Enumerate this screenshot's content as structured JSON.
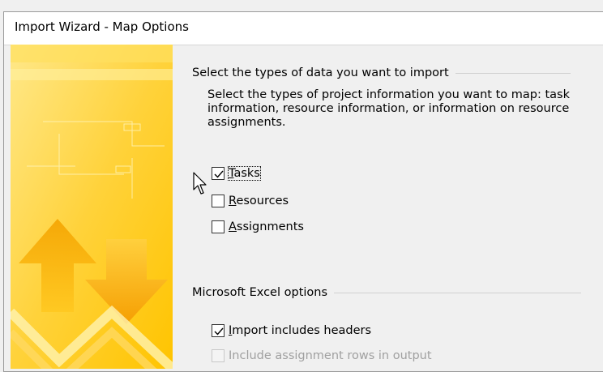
{
  "dialog": {
    "title": "Import Wizard - Map Options"
  },
  "section_data": {
    "header": "Select the types of data you want to import",
    "description": "Select the types of project information you want to map: task information, resource information, or information on resource assignments.",
    "options": [
      {
        "accel": "T",
        "rest": "asks",
        "checked": true,
        "enabled": true
      },
      {
        "accel": "R",
        "rest": "esources",
        "checked": false,
        "enabled": true
      },
      {
        "accel": "A",
        "rest": "ssignments",
        "checked": false,
        "enabled": true
      }
    ]
  },
  "section_excel": {
    "header": "Microsoft Excel options",
    "options": [
      {
        "accel": "I",
        "rest": "mport includes headers",
        "checked": true,
        "enabled": true
      },
      {
        "accel": "",
        "rest": "Include assignment rows in output",
        "checked": false,
        "enabled": false
      }
    ]
  },
  "colors": {
    "banner_yellow": "#ffd84a",
    "banner_orange": "#f7a800",
    "dialog_bg": "#f0f0f0"
  }
}
